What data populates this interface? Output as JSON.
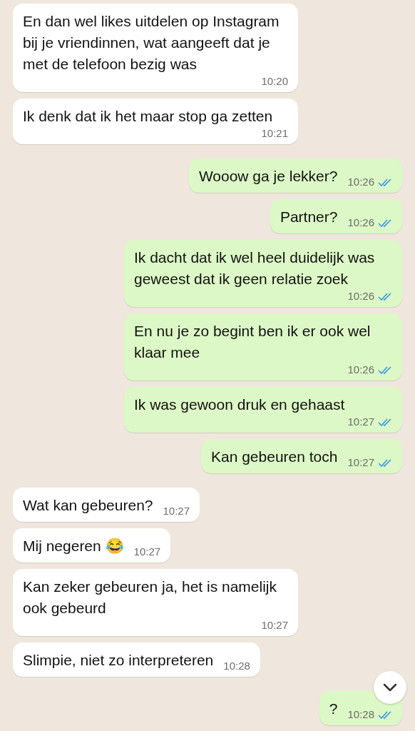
{
  "messages": [
    {
      "kind": "incoming",
      "text": "En dan wel likes uitdelen op Instagram bij je vriendinnen, wat aangeeft dat je met de telefoon bezig was",
      "time": "10:20"
    },
    {
      "kind": "incoming",
      "text": "Ik denk dat ik het maar stop ga zetten",
      "time": "10:21"
    },
    {
      "kind": "outgoing",
      "text": "Wooow ga je lekker?",
      "time": "10:26",
      "read": true
    },
    {
      "kind": "outgoing",
      "text": "Partner?",
      "time": "10:26",
      "read": true
    },
    {
      "kind": "outgoing",
      "text": "Ik dacht dat ik wel heel duidelijk was geweest dat ik geen relatie zoek",
      "time": "10:26",
      "read": true
    },
    {
      "kind": "outgoing",
      "text": "En nu je zo begint ben ik er ook wel klaar mee",
      "time": "10:26",
      "read": true
    },
    {
      "kind": "outgoing",
      "text": "Ik was gewoon druk en gehaast",
      "time": "10:27",
      "read": true
    },
    {
      "kind": "outgoing",
      "text": "Kan gebeuren toch",
      "time": "10:27",
      "read": true
    },
    {
      "kind": "incoming",
      "text": "Wat kan gebeuren?",
      "time": "10:27"
    },
    {
      "kind": "incoming",
      "text": "Mij negeren 😂",
      "time": "10:27"
    },
    {
      "kind": "incoming",
      "text": "Kan zeker gebeuren ja, het is namelijk ook gebeurd",
      "time": "10:27"
    },
    {
      "kind": "incoming",
      "text": "Slimpie, niet zo interpreteren",
      "time": "10:28"
    },
    {
      "kind": "outgoing",
      "text": "?",
      "time": "10:28",
      "read": true
    }
  ]
}
